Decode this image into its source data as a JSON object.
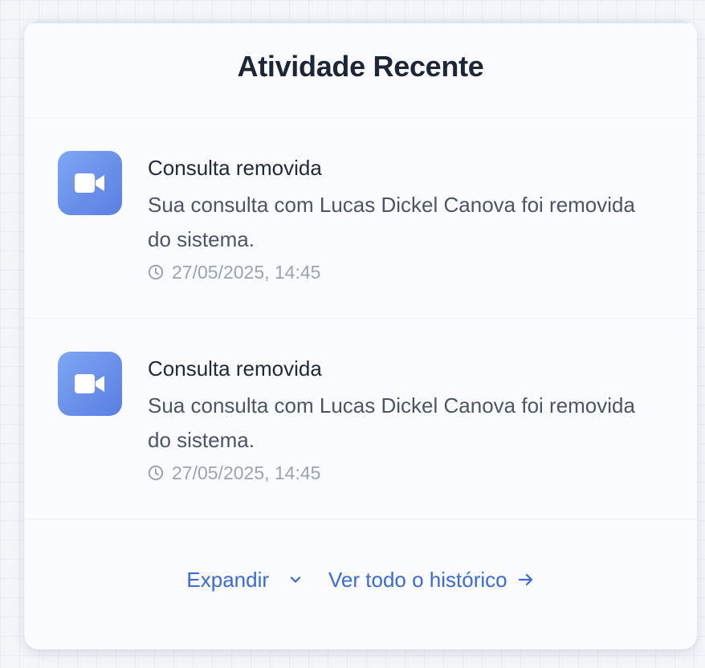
{
  "card": {
    "title": "Atividade Recente"
  },
  "activities": [
    {
      "icon": "video-camera-icon",
      "title": "Consulta removida",
      "description": "Sua consulta com Lucas Dickel Canova foi removida do sistema.",
      "timestamp": "27/05/2025, 14:45"
    },
    {
      "icon": "video-camera-icon",
      "title": "Consulta removida",
      "description": "Sua consulta com Lucas Dickel Canova foi removida do sistema.",
      "timestamp": "27/05/2025, 14:45"
    }
  ],
  "footer": {
    "expand_label": "Expandir",
    "history_label": "Ver todo o histórico"
  },
  "colors": {
    "accent": "#3a6ad8",
    "icon_gradient_start": "#7ea7f5",
    "icon_gradient_end": "#5b7fe3",
    "title_text": "#1d2636",
    "muted_text": "#9ca3af"
  }
}
